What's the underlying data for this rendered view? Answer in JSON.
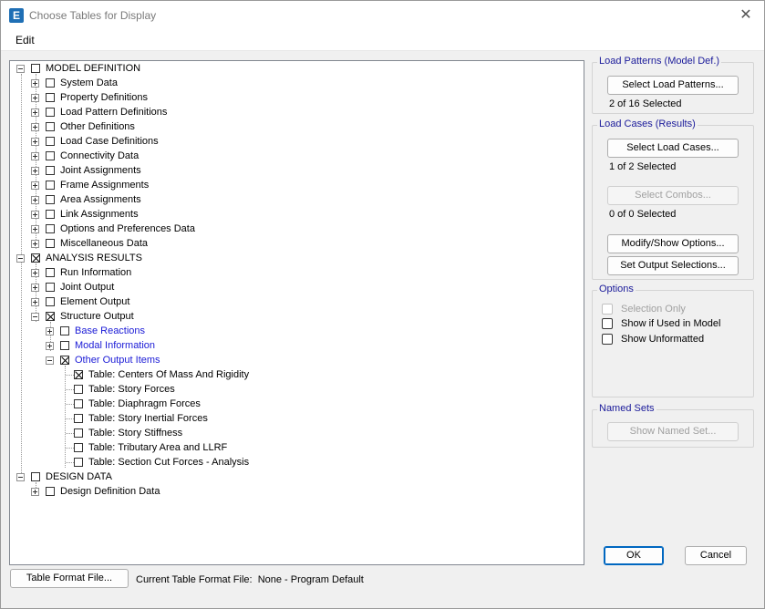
{
  "window": {
    "title": "Choose Tables for Display",
    "app_icon": "E"
  },
  "menu": {
    "edit": "Edit"
  },
  "tree": {
    "model_definition": "MODEL DEFINITION",
    "system_data": "System Data",
    "property_definitions": "Property Definitions",
    "load_pattern_definitions": "Load Pattern Definitions",
    "other_definitions": "Other Definitions",
    "load_case_definitions": "Load Case Definitions",
    "connectivity_data": "Connectivity Data",
    "joint_assignments": "Joint Assignments",
    "frame_assignments": "Frame Assignments",
    "area_assignments": "Area Assignments",
    "link_assignments": "Link Assignments",
    "options_preferences": "Options and Preferences Data",
    "miscellaneous_data": "Miscellaneous Data",
    "analysis_results": "ANALYSIS RESULTS",
    "run_information": "Run Information",
    "joint_output": "Joint Output",
    "element_output": "Element Output",
    "structure_output": "Structure Output",
    "base_reactions": "Base Reactions",
    "modal_information": "Modal Information",
    "other_output_items": "Other Output Items",
    "centers_of_mass": "Table:  Centers Of Mass And Rigidity",
    "story_forces": "Table:  Story Forces",
    "diaphragm_forces": "Table:  Diaphragm Forces",
    "story_inertial_forces": "Table:  Story Inertial Forces",
    "story_stiffness": "Table:  Story Stiffness",
    "tributary_area": "Table:  Tributary Area and LLRF",
    "section_cut_forces": "Table:  Section Cut Forces - Analysis",
    "design_data": "DESIGN DATA",
    "design_definition_data": "Design Definition Data"
  },
  "load_patterns": {
    "title": "Load Patterns (Model Def.)",
    "button": "Select Load Patterns...",
    "status": "2 of 16 Selected"
  },
  "load_cases": {
    "title": "Load Cases (Results)",
    "button": "Select Load Cases...",
    "status": "1 of 2 Selected",
    "combos_button": "Select Combos...",
    "combos_status": "0 of 0 Selected",
    "modify_button": "Modify/Show Options...",
    "output_button": "Set Output Selections..."
  },
  "options": {
    "title": "Options",
    "selection_only": "Selection Only",
    "show_if_used": "Show if Used in Model",
    "show_unformatted": "Show Unformatted"
  },
  "named_sets": {
    "title": "Named Sets",
    "button": "Show Named Set..."
  },
  "footer": {
    "table_format_button": "Table Format File...",
    "current_format_label": "Current Table Format File:",
    "current_format_value": "None - Program Default",
    "ok": "OK",
    "cancel": "Cancel"
  }
}
